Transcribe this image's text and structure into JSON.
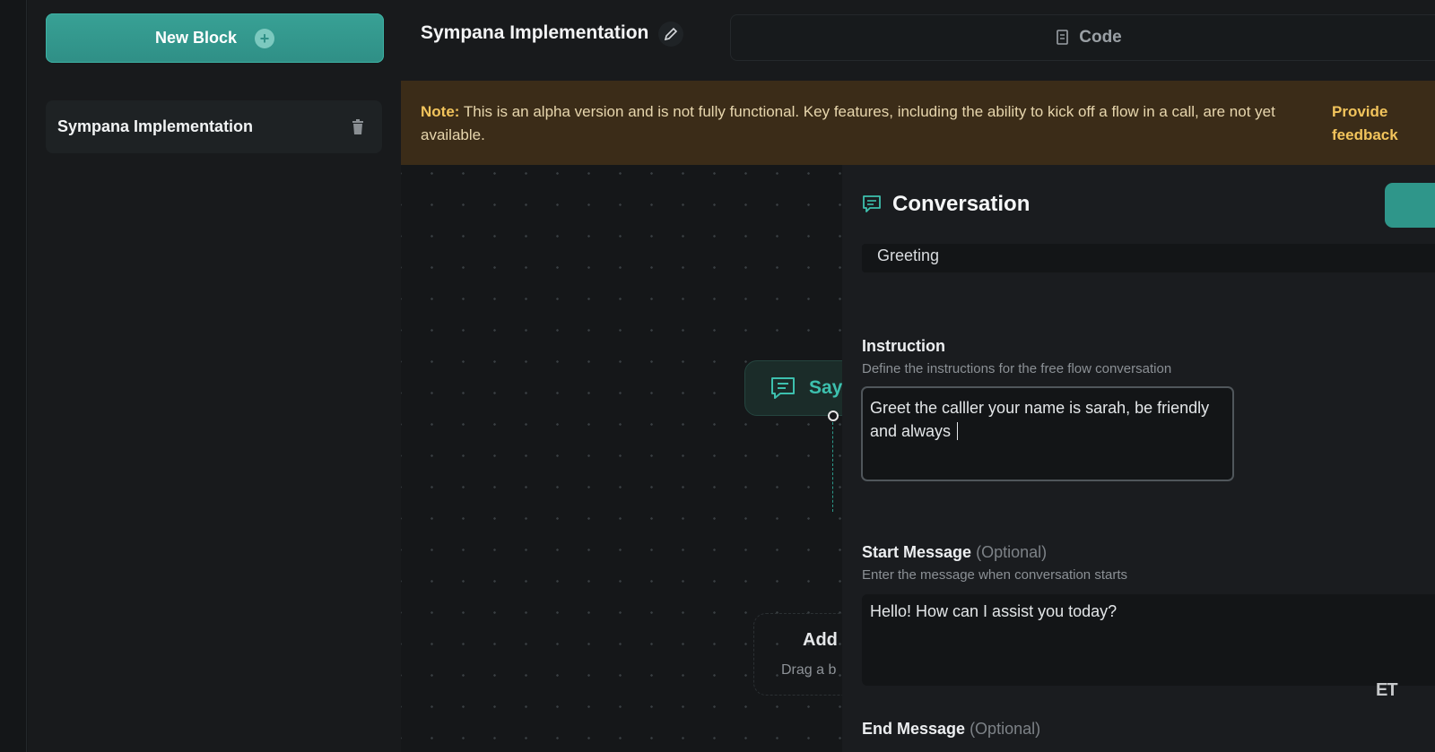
{
  "sidebar": {
    "new_block_label": "New Block",
    "flows": [
      {
        "label": "Sympana Implementation"
      }
    ]
  },
  "header": {
    "title": "Sympana Implementation",
    "code_tab_label": "Code"
  },
  "notice": {
    "prefix": "Note:",
    "text": "This is an alpha version and is not fully functional. Key features, including the ability to kick off a flow in a call, are not yet available.",
    "link_label": "Provide feedback"
  },
  "canvas": {
    "say_node_label": "Say",
    "add_node_title": "Add",
    "add_node_subtitle": "Drag a b"
  },
  "panel": {
    "title": "Conversation",
    "name_value": "Greeting",
    "instruction": {
      "label": "Instruction",
      "help": "Define the instructions for the free flow conversation",
      "value": "Greet the calller your name is sarah, be friendly and always "
    },
    "start_message": {
      "label": "Start Message",
      "optional": "(Optional)",
      "help": "Enter the message when conversation starts",
      "value": "Hello! How can I assist you today?"
    },
    "end_message": {
      "label": "End Message",
      "optional": "(Optional)"
    }
  },
  "watermark": "ET",
  "colors": {
    "accent": "#2f968a",
    "notice_bg": "#3b2c18",
    "notice_highlight": "#f2c45c"
  }
}
